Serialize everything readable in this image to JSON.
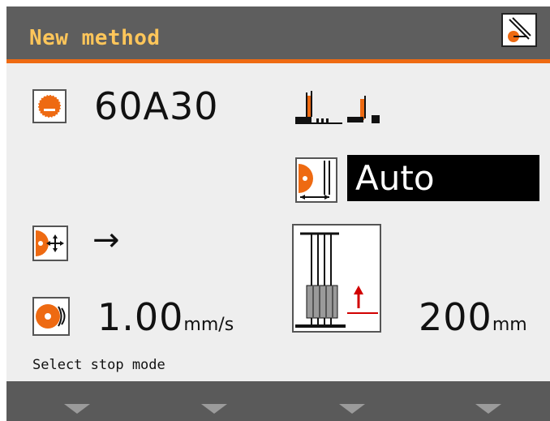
{
  "header": {
    "title": "New method",
    "icon": "method-settings-icon"
  },
  "wheel": {
    "value": "60A30",
    "icon": "cutoff-wheel-icon"
  },
  "cut_mode": {
    "icon_left": "step-cut-icon",
    "icon_right": "single-cut-icon"
  },
  "wheel_size": {
    "value": "Auto",
    "icon": "wheel-size-icon"
  },
  "stop_mode": {
    "arrow": "→",
    "icon": "stop-mode-icon"
  },
  "feed_speed": {
    "value": "1.00",
    "unit": "mm/s",
    "icon": "feed-speed-icon"
  },
  "cut_length": {
    "value": "200",
    "unit": "mm",
    "icon": "cut-length-icon"
  },
  "status": {
    "text": "Select stop mode"
  },
  "softkeys": [
    "softkey-1",
    "softkey-2",
    "softkey-3",
    "softkey-4"
  ],
  "colors": {
    "accent": "#ee6a12",
    "title": "#ffc65a",
    "bar": "#5e5e5e"
  }
}
